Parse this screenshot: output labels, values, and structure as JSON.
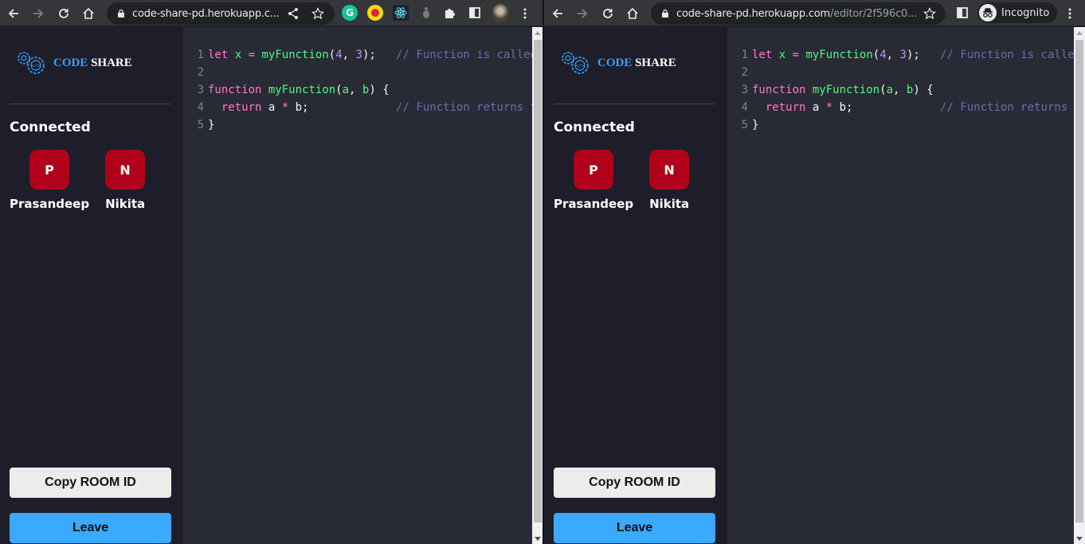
{
  "windows": [
    {
      "id": "left",
      "toolbar": {
        "url_host": "code-share-pd.herokuapp.c...",
        "url_path": "",
        "extensions": [
          "grammarly-icon",
          "colorpick-icon",
          "react-devtools-icon",
          "extension-bug-icon",
          "extensions-puzzle-icon",
          "side-panel-icon"
        ],
        "profile": "profile-avatar"
      }
    },
    {
      "id": "right",
      "toolbar": {
        "url_host": "code-share-pd.herokuapp.com",
        "url_path": "/editor/2f596c0...",
        "incognito_label": "Incognito"
      }
    }
  ],
  "app": {
    "logo": {
      "code": "CODE",
      "share": "SHARE"
    },
    "connected_title": "Connected",
    "clients": [
      {
        "initial": "P",
        "name": "Prasandeep"
      },
      {
        "initial": "N",
        "name": "Nikita"
      }
    ],
    "copy_button": "Copy ROOM ID",
    "leave_button": "Leave",
    "colors": {
      "avatar": "#b0001a",
      "leave": "#3aa9ff",
      "logo_code": "#3a9ff3"
    }
  },
  "editor": {
    "lines": [
      {
        "n": "1",
        "tokens": [
          [
            "kw",
            "let"
          ],
          [
            "pl",
            " "
          ],
          [
            "var",
            "x"
          ],
          [
            "pl",
            " "
          ],
          [
            "op",
            "="
          ],
          [
            "pl",
            " "
          ],
          [
            "fn",
            "myFunction"
          ],
          [
            "pl",
            "("
          ],
          [
            "num",
            "4"
          ],
          [
            "pl",
            ", "
          ],
          [
            "num",
            "3"
          ],
          [
            "pl",
            ");   "
          ],
          [
            "cm",
            "// Function is called, return value will end up in x"
          ]
        ]
      },
      {
        "n": "2",
        "tokens": []
      },
      {
        "n": "3",
        "tokens": [
          [
            "kw",
            "function"
          ],
          [
            "pl",
            " "
          ],
          [
            "fn",
            "myFunction"
          ],
          [
            "pl",
            "("
          ],
          [
            "param",
            "a"
          ],
          [
            "pl",
            ", "
          ],
          [
            "param",
            "b"
          ],
          [
            "pl",
            ") {"
          ]
        ]
      },
      {
        "n": "4",
        "tokens": [
          [
            "pl",
            "  "
          ],
          [
            "kw",
            "return"
          ],
          [
            "pl",
            " a "
          ],
          [
            "op",
            "*"
          ],
          [
            "pl",
            " b;             "
          ],
          [
            "cm",
            "// Function returns the product of a and b"
          ]
        ]
      },
      {
        "n": "5",
        "tokens": [
          [
            "pl",
            "}"
          ]
        ]
      }
    ]
  }
}
